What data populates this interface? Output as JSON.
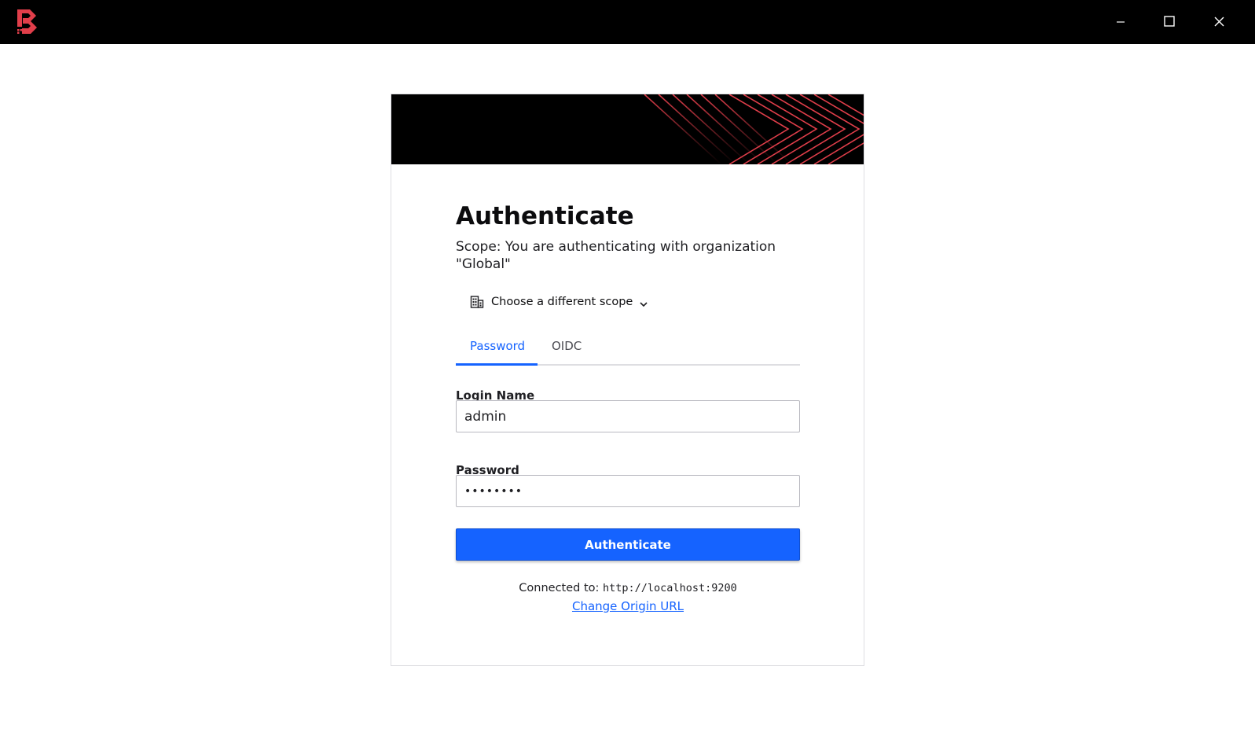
{
  "window": {
    "logo_icon": "boundary-logo-icon",
    "brand_color": "#e03e4a",
    "controls": {
      "minimize_icon": "minimize-icon",
      "maximize_icon": "maximize-icon",
      "close_icon": "close-icon"
    }
  },
  "auth": {
    "title": "Authenticate",
    "scope_description": "Scope: You are authenticating with organization \"Global\"",
    "scope_picker": {
      "icon": "building-icon",
      "label": "Choose a different scope",
      "chevron_icon": "chevron-down-icon"
    },
    "tabs": [
      {
        "label": "Password",
        "active": true
      },
      {
        "label": "OIDC",
        "active": false
      }
    ],
    "login_name": {
      "label": "Login Name",
      "value": "admin"
    },
    "password": {
      "label": "Password",
      "value": "••••••••"
    },
    "submit_label": "Authenticate",
    "connected_prefix": "Connected to:",
    "connected_url": "http://localhost:9200",
    "change_origin_label": "Change Origin URL"
  },
  "colors": {
    "accent": "#1563ff",
    "titlebar": "#000000",
    "banner_lines": "#e03e4a"
  }
}
